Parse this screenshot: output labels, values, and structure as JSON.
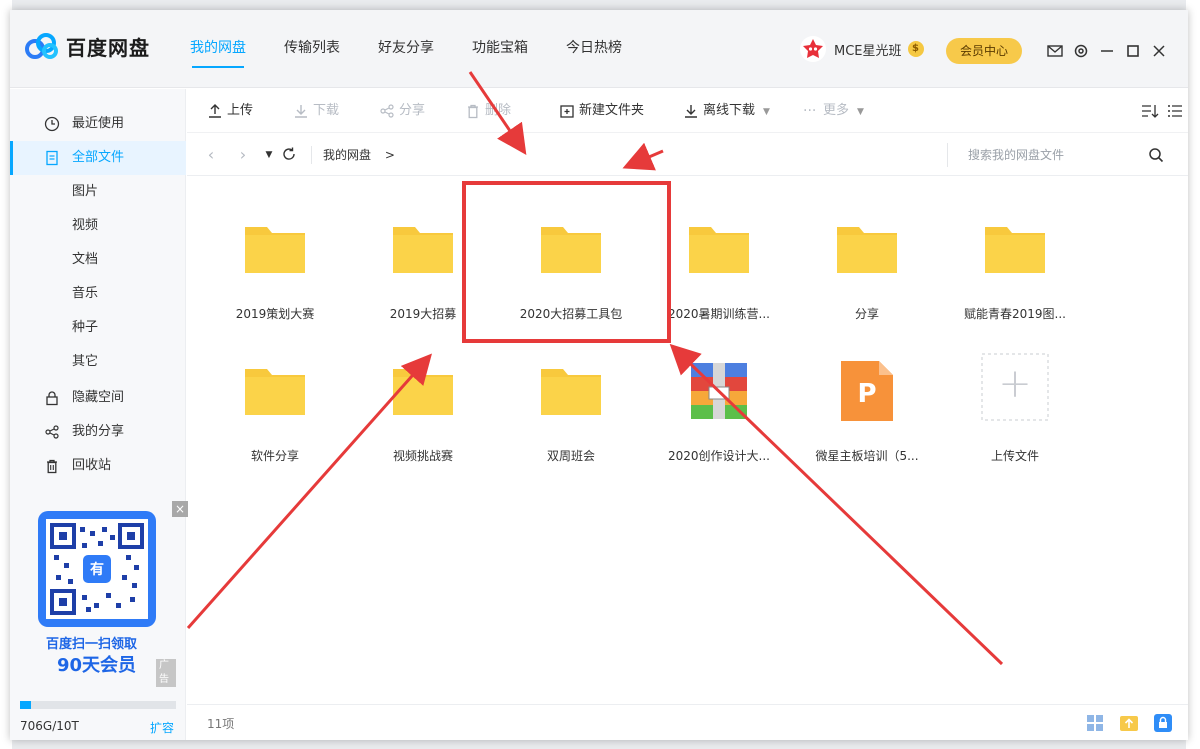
{
  "app": {
    "brand": "百度网盘",
    "nav": [
      "我的网盘",
      "传输列表",
      "好友分享",
      "功能宝箱",
      "今日热榜"
    ],
    "active_nav": 0,
    "user": {
      "name": "MCE星光班",
      "coin": "$"
    },
    "vip_button": "会员中心"
  },
  "sidebar": {
    "items": [
      {
        "label": "最近使用",
        "icon": "clock-icon"
      },
      {
        "label": "全部文件",
        "icon": "document-icon",
        "active": true
      },
      {
        "label": "图片"
      },
      {
        "label": "视频"
      },
      {
        "label": "文档"
      },
      {
        "label": "音乐"
      },
      {
        "label": "种子"
      },
      {
        "label": "其它"
      },
      {
        "label": "隐藏空间",
        "icon": "lock-icon"
      },
      {
        "label": "我的分享",
        "icon": "share-icon"
      },
      {
        "label": "回收站",
        "icon": "trash-icon"
      }
    ],
    "ad": {
      "line1": "百度扫一扫领取",
      "line2": "90天会员",
      "tag": "广告",
      "close": "×",
      "qr_center": "有"
    },
    "storage": {
      "text": "706G/10T",
      "used_fraction": 0.07,
      "expand": "扩容"
    }
  },
  "toolbar": {
    "upload": "上传",
    "download": "下载",
    "share": "分享",
    "delete": "删除",
    "new_folder": "新建文件夹",
    "offline_download": "离线下载",
    "more": "更多"
  },
  "address": {
    "crumb": "我的网盘",
    "crumb_sep": ">",
    "search_placeholder": "搜索我的网盘文件"
  },
  "files": [
    {
      "name": "2019策划大赛",
      "type": "folder"
    },
    {
      "name": "2019大招募",
      "type": "folder"
    },
    {
      "name": "2020大招募工具包",
      "type": "folder"
    },
    {
      "name": "2020暑期训练营...",
      "type": "folder"
    },
    {
      "name": "分享",
      "type": "folder"
    },
    {
      "name": "赋能青春2019图...",
      "type": "folder"
    },
    {
      "name": "软件分享",
      "type": "folder"
    },
    {
      "name": "视频挑战赛",
      "type": "folder"
    },
    {
      "name": "双周班会",
      "type": "folder"
    },
    {
      "name": "2020创作设计大...",
      "type": "archive"
    },
    {
      "name": "微星主板培训（5...",
      "type": "ppt",
      "glyph": "P"
    },
    {
      "name": "上传文件",
      "type": "upload",
      "glyph": "+"
    }
  ],
  "status": {
    "count": "11项"
  },
  "colors": {
    "accent": "#06a7ff",
    "folder": "#f8c93d",
    "annotation": "#e63a3a",
    "vip": "#f7c94a"
  }
}
